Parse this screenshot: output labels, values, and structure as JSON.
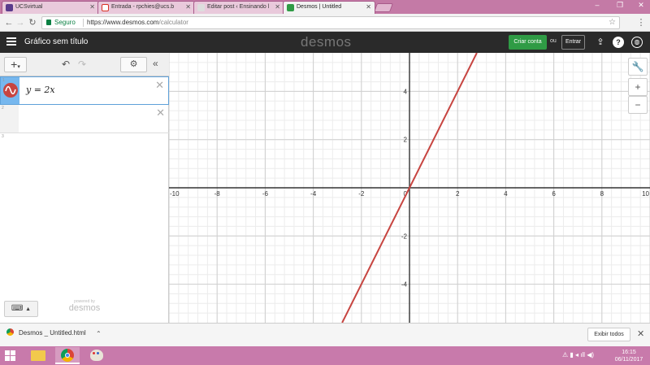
{
  "browser": {
    "tabs": [
      {
        "title": "UCSvirtual",
        "icon": "ucs-icon",
        "color": "#5a3a8c"
      },
      {
        "title": "Entrada - rpchies@ucs.b",
        "icon": "gmail-icon",
        "color": "#d93025"
      },
      {
        "title": "Editar post ‹ Ensinando l",
        "icon": "page-icon",
        "color": "#999999"
      },
      {
        "title": "Desmos | Untitled",
        "icon": "desmos-icon",
        "color": "#2f9b45"
      }
    ],
    "secure_label": "Seguro",
    "url_host": "https://www.desmos.com",
    "url_path": "/calculator"
  },
  "header": {
    "title": "Gráfico sem título",
    "logo": "desmos",
    "create_account": "Criar conta",
    "or": "ou",
    "sign_in": "Entrar"
  },
  "expressions": {
    "items": [
      {
        "number": "1",
        "latex": "y = 2x",
        "color": "#c74440"
      },
      {
        "number": "2",
        "latex": ""
      },
      {
        "number": "3",
        "latex": ""
      }
    ]
  },
  "powered": {
    "by": "powered by",
    "logo": "desmos"
  },
  "graph": {
    "x_range": [
      -10,
      10
    ],
    "y_range": [
      -5.6,
      5.6
    ],
    "x_ticks": [
      "-10",
      "-8",
      "-6",
      "-4",
      "-2",
      "0",
      "2",
      "4",
      "6",
      "8",
      "10"
    ],
    "y_ticks": [
      "4",
      "2",
      "-2",
      "-4"
    ],
    "line": {
      "slope": 2,
      "intercept": 0,
      "color": "#c74440"
    }
  },
  "download": {
    "file": "Desmos _ Untitled.html",
    "show_all": "Exibir todos"
  },
  "taskbar": {
    "time": "16:15",
    "date": "06/11/2017"
  }
}
